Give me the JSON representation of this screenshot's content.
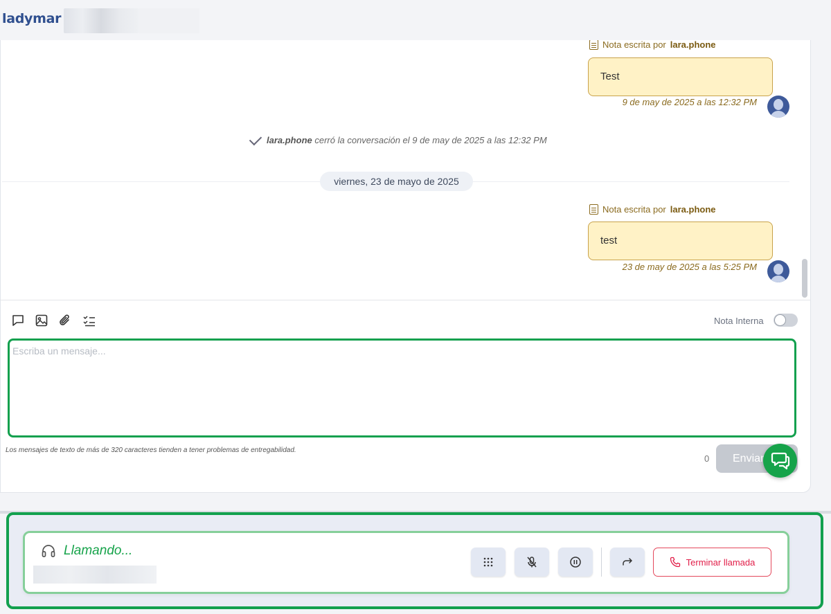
{
  "header": {
    "brand": "ladymar"
  },
  "conversation": {
    "notes": [
      {
        "prefix": "Nota escrita por",
        "author": "lara.phone",
        "text": "Test",
        "timestamp": "9 de may de 2025 a las 12:32 PM"
      },
      {
        "prefix": "Nota escrita por",
        "author": "lara.phone",
        "text": "test",
        "timestamp": "23 de may de 2025 a las 5:25 PM"
      }
    ],
    "closed_event": {
      "user": "lara.phone",
      "text": "cerró la conversación el 9 de may de 2025 a las 12:32 PM"
    },
    "date_divider": "viernes, 23 de mayo de 2025"
  },
  "composer": {
    "tools": [
      "message-icon",
      "image-icon",
      "paperclip-icon",
      "checklist-icon"
    ],
    "internal_note_label": "Nota Interna",
    "internal_note_on": false,
    "placeholder": "Escriba un mensaje...",
    "hint": "Los mensajes de texto de más de 320 caracteres tienden a tener problemas de entregabilidad.",
    "char_count": "0",
    "send_label": "Enviar"
  },
  "call": {
    "status": "Llamando...",
    "end_label": "Terminar llamada",
    "buttons": [
      "dialpad-icon",
      "mic-off-icon",
      "pause-icon",
      "transfer-icon"
    ],
    "accent": "#16a34a",
    "danger": "#e11d48"
  }
}
